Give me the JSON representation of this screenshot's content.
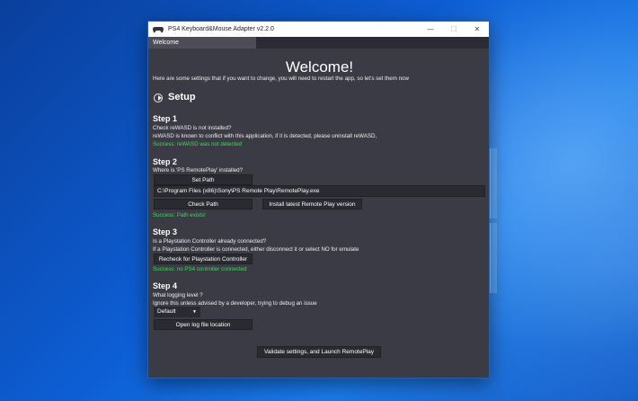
{
  "window": {
    "title": "PS4 Keyboard&Mouse Adapter v2.2.0",
    "controls": {
      "minimize": "—",
      "maximize": "☐",
      "close": "✕"
    }
  },
  "tabs": [
    {
      "label": "Welcome"
    }
  ],
  "header": {
    "title": "Welcome!",
    "intro": "Here are some settings that if you want to change, you will need to restart the app, so let's set them now"
  },
  "section": {
    "title": "Setup",
    "icon": "chevron-circle-icon"
  },
  "step1": {
    "heading": "Step 1",
    "question": "Check reWASD is not installed?",
    "description": "reWASD is known to conflict with this application, if it is detected, please uninstall reWASD,",
    "status": "Success: reWASD was not detected"
  },
  "step2": {
    "heading": "Step 2",
    "question": "Where is 'PS RemotePlay' installed?",
    "set_path_label": "Set Path",
    "path_value": "C:\\Program Files (x86)\\Sony\\PS Remote Play\\RemotePlay.exe",
    "check_path_label": "Check Path",
    "install_label": "Install latest Remote Play version",
    "status": "Success: Path exists!"
  },
  "step3": {
    "heading": "Step 3",
    "question": "Is a Playstation Controller already connected?",
    "description": "If a Playstation Controller is connected, either disconnect it or select NO for emulate",
    "recheck_label": "Recheck for Playstation Controller",
    "status": "Success: no PS4 controller connected"
  },
  "step4": {
    "heading": "Step 4",
    "question": "What logging level ?",
    "description": "Ignore this unless advised by a developer, trying to debug an issue",
    "log_level": "Default",
    "open_log_label": "Open log file location"
  },
  "footer": {
    "launch_label": "Validate settings, and Launch RemotePlay"
  },
  "colors": {
    "background": "#3b3b45",
    "success": "#3ddb5a",
    "button": "#2a2a31"
  }
}
